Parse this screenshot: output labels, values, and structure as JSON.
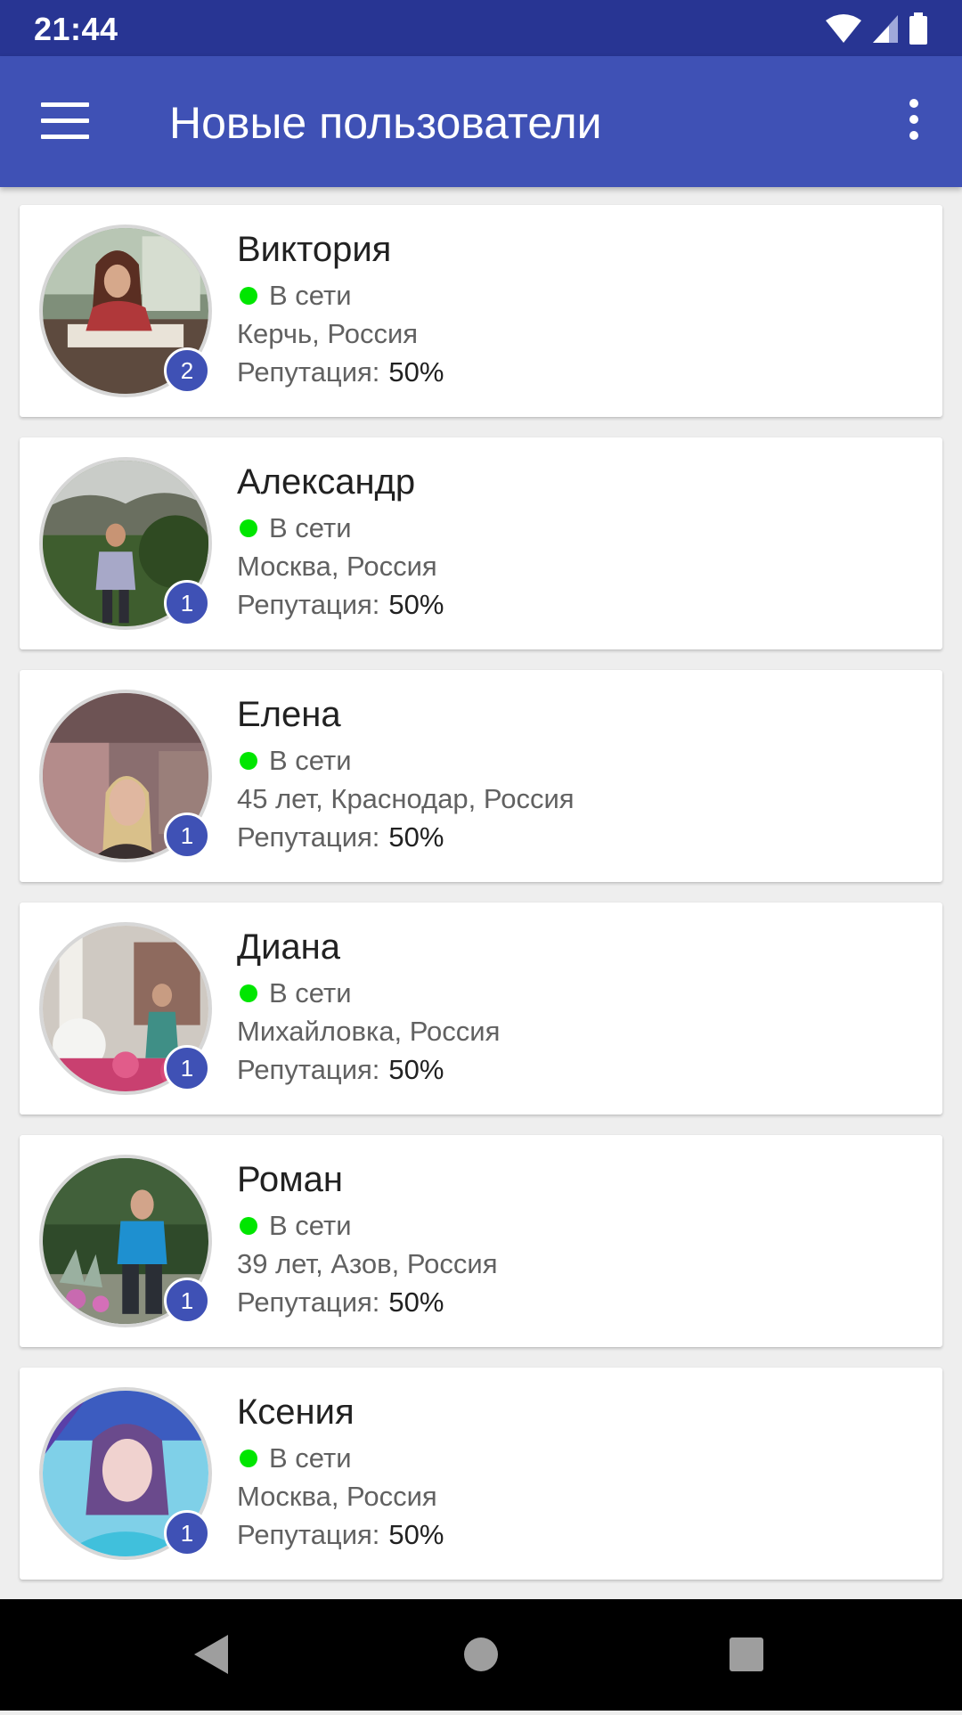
{
  "status_bar": {
    "time": "21:44"
  },
  "app_bar": {
    "title": "Новые пользователи"
  },
  "users": [
    {
      "name": "Виктория",
      "status": "В сети",
      "location": "Керчь, Россия",
      "reputation_label": "Репутация:",
      "reputation_value": "50%",
      "badge": "2",
      "photo": "woman-at-cafe-table-photo"
    },
    {
      "name": "Александр",
      "status": "В сети",
      "location": "Москва, Россия",
      "reputation_label": "Репутация:",
      "reputation_value": "50%",
      "badge": "1",
      "photo": "man-in-mountains-photo"
    },
    {
      "name": "Елена",
      "status": "В сети",
      "location": "45 лет, Краснодар, Россия",
      "reputation_label": "Репутация:",
      "reputation_value": "50%",
      "badge": "1",
      "photo": "woman-in-room-photo"
    },
    {
      "name": "Диана",
      "status": "В сети",
      "location": "Михайловка, Россия",
      "reputation_label": "Репутация:",
      "reputation_value": "50%",
      "badge": "1",
      "photo": "woman-with-flowers-photo"
    },
    {
      "name": "Роман",
      "status": "В сети",
      "location": "39 лет, Азов, Россия",
      "reputation_label": "Репутация:",
      "reputation_value": "50%",
      "badge": "1",
      "photo": "man-in-garden-photo"
    },
    {
      "name": "Ксения",
      "status": "В сети",
      "location": "Москва, Россия",
      "reputation_label": "Репутация:",
      "reputation_value": "50%",
      "badge": "1",
      "photo": "girl-selfie-photo"
    }
  ],
  "colors": {
    "primary": "#3f51b5",
    "primary_dark": "#283593",
    "online": "#00e600"
  }
}
